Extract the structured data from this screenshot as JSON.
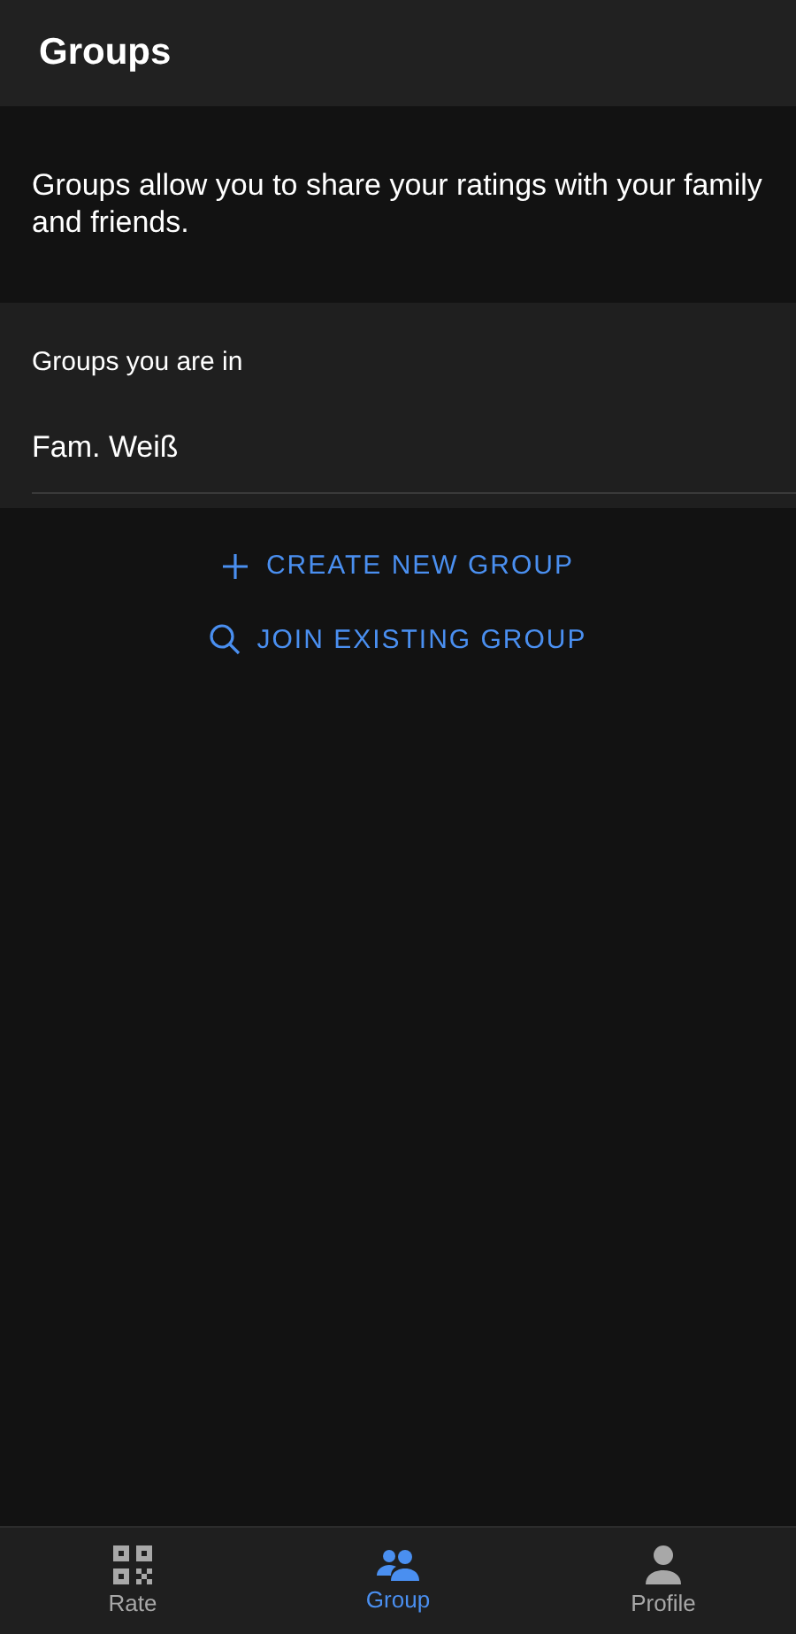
{
  "header": {
    "title": "Groups"
  },
  "intro": "Groups allow you to share your ratings with your family and friends.",
  "groups_section": {
    "heading": "Groups you are in",
    "items": [
      "Fam. Weiß"
    ]
  },
  "actions": [
    {
      "kind": "plus",
      "label": "CREATE NEW GROUP"
    },
    {
      "kind": "search",
      "label": "JOIN EXISTING GROUP"
    }
  ],
  "bottom_nav": [
    {
      "kind": "qr",
      "label": "Rate",
      "selected": false
    },
    {
      "kind": "group",
      "label": "Group",
      "selected": true
    },
    {
      "kind": "person",
      "label": "Profile",
      "selected": false
    }
  ]
}
